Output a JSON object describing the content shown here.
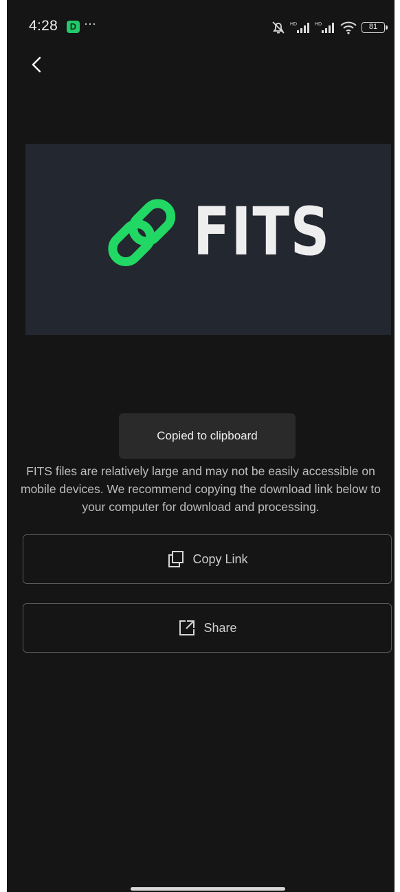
{
  "status_bar": {
    "time": "4:28",
    "app_badge": "D",
    "more": "···",
    "battery": "81",
    "icons": [
      "silent-bell-icon",
      "signal-hd-icon",
      "signal-hd-icon",
      "wifi-icon",
      "battery-icon"
    ]
  },
  "banner": {
    "logo_text": "FITS",
    "accent_color": "#22d865",
    "background_color": "#232730"
  },
  "toast": {
    "message": "Copied to clipboard"
  },
  "description": "FITS files are relatively large and may not be easily accessible on mobile devices. We recommend copying the download link below to your computer for download and processing.",
  "actions": {
    "copy_label": "Copy Link",
    "share_label": "Share"
  },
  "theme": {
    "background": "#151515",
    "text": "#bdbdbd",
    "border": "#5a5a5a"
  }
}
